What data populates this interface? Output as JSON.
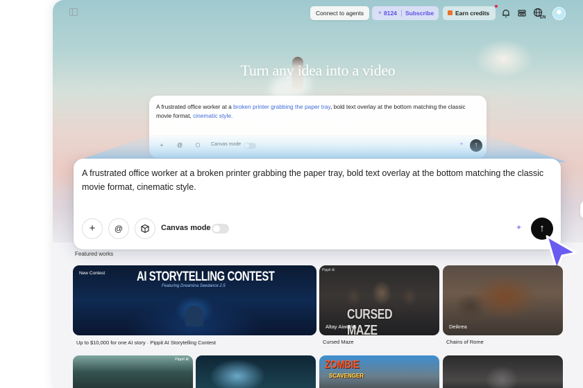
{
  "topbar": {
    "connect_label": "Connect to agents",
    "credits_count": "8124",
    "subscribe_label": "Subscribe",
    "earn_label": "Earn credits",
    "lang_label": "EN",
    "icons": [
      "sidebar-toggle-icon",
      "sparkle-icon",
      "gift-icon",
      "bell-icon",
      "stack-icon",
      "globe-icon"
    ]
  },
  "hero": {
    "title": "Turn any idea into a video"
  },
  "prompt_background": {
    "text_a": "A frustrated office worker at a ",
    "text_link1": "broken printer grabbing the paper tray",
    "text_b": ", bold text overlay at the bottom matching the classic movie format, ",
    "text_link2": "cinematic style.",
    "canvas_label": "Canvas mode"
  },
  "prompt": {
    "text": "A frustrated office worker at a broken printer grabbing the paper tray, bold text overlay at the bottom matching the classic movie format, cinematic style.",
    "add_glyph": "+",
    "mention_glyph": "@",
    "canvas_label": "Canvas mode",
    "canvas_mode_on": false,
    "send_glyph": "↑",
    "accent": "#9b8cf5"
  },
  "featured": {
    "label": "Featured works",
    "cards": [
      {
        "badge": "New Contest",
        "headline": "AI STORYTELLING CONTEST",
        "subline": "Featuring Dreamina Seedance 2.5",
        "caption": "Up to $10,000 for one AI story · Pippit AI Storytelling Contest"
      },
      {
        "tag": "Pippit ⊞",
        "poster_text": "CURSED MAZE",
        "author": "Altay Aiworks",
        "caption": "Cursed Maze"
      },
      {
        "author": "Deikrea",
        "caption": "Chains of Rome"
      },
      {
        "tag": "Pippit ⊞"
      },
      {},
      {
        "poster_text": "ZOMBIE",
        "poster_sub": "SCAVENGER"
      },
      {}
    ]
  },
  "colors": {
    "brand_purple": "#5b50e8",
    "send_button": "#0d0d0d",
    "cursor": "#6a5cf0"
  }
}
